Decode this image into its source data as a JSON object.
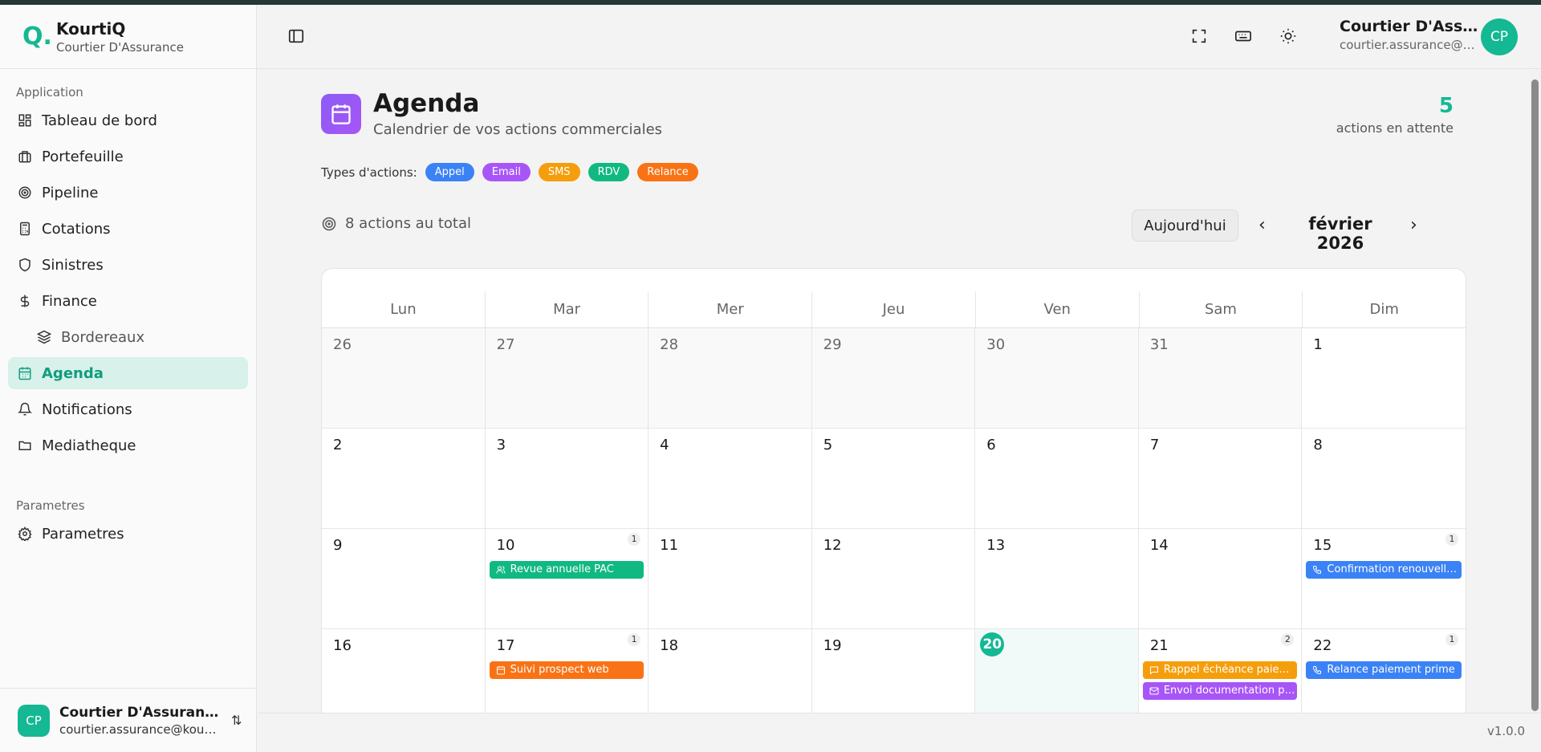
{
  "brand": {
    "logo": "Q.",
    "name": "KourtiQ",
    "subtitle": "Courtier D'Assurance"
  },
  "sidebar": {
    "section_app": "Application",
    "items": [
      {
        "label": "Tableau de bord",
        "icon": "dashboard-icon"
      },
      {
        "label": "Portefeuille",
        "icon": "briefcase-icon"
      },
      {
        "label": "Pipeline",
        "icon": "target-icon"
      },
      {
        "label": "Cotations",
        "icon": "calculator-icon"
      },
      {
        "label": "Sinistres",
        "icon": "shield-icon"
      },
      {
        "label": "Finance",
        "icon": "dollar-icon"
      },
      {
        "label": "Bordereaux",
        "icon": "layers-icon"
      },
      {
        "label": "Agenda",
        "icon": "calendar-icon"
      },
      {
        "label": "Notifications",
        "icon": "bell-icon"
      },
      {
        "label": "Mediatheque",
        "icon": "folder-icon"
      }
    ],
    "section_params": "Parametres",
    "params_item": {
      "label": "Parametres",
      "icon": "gear-icon"
    },
    "active": "Agenda"
  },
  "user": {
    "initials": "CP",
    "name": "Courtier D'Assurance",
    "email": "courtier.assurance@kourtiq.com"
  },
  "page": {
    "title": "Agenda",
    "subtitle": "Calendrier de vos actions commerciales",
    "pending_count": "5",
    "pending_label": "actions en attente",
    "types_label": "Types d'actions:",
    "types": [
      {
        "label": "Appel",
        "color": "#3b82f6"
      },
      {
        "label": "Email",
        "color": "#a855f7"
      },
      {
        "label": "SMS",
        "color": "#f59e0b"
      },
      {
        "label": "RDV",
        "color": "#10b981"
      },
      {
        "label": "Relance",
        "color": "#f97316"
      }
    ],
    "total": "8 actions au total",
    "today_button": "Aujourd'hui",
    "month": "février 2026"
  },
  "calendar": {
    "weekdays": [
      "Lun",
      "Mar",
      "Mer",
      "Jeu",
      "Ven",
      "Sam",
      "Dim"
    ],
    "days": [
      {
        "n": "26",
        "other": true
      },
      {
        "n": "27",
        "other": true
      },
      {
        "n": "28",
        "other": true
      },
      {
        "n": "29",
        "other": true
      },
      {
        "n": "30",
        "other": true
      },
      {
        "n": "31",
        "other": true
      },
      {
        "n": "1"
      },
      {
        "n": "2"
      },
      {
        "n": "3"
      },
      {
        "n": "4"
      },
      {
        "n": "5"
      },
      {
        "n": "6"
      },
      {
        "n": "7"
      },
      {
        "n": "8"
      },
      {
        "n": "9"
      },
      {
        "n": "10",
        "count": "1",
        "events": [
          {
            "title": "Revue annuelle PAC",
            "type": "RDV"
          }
        ]
      },
      {
        "n": "11"
      },
      {
        "n": "12"
      },
      {
        "n": "13"
      },
      {
        "n": "14"
      },
      {
        "n": "15",
        "count": "1",
        "events": [
          {
            "title": "Confirmation renouvellement",
            "type": "Appel"
          }
        ]
      },
      {
        "n": "16"
      },
      {
        "n": "17",
        "count": "1",
        "events": [
          {
            "title": "Suivi prospect web",
            "type": "Relance"
          }
        ]
      },
      {
        "n": "18"
      },
      {
        "n": "19"
      },
      {
        "n": "20",
        "today": true
      },
      {
        "n": "21",
        "count": "2",
        "events": [
          {
            "title": "Rappel échéance paiement",
            "type": "SMS"
          },
          {
            "title": "Envoi documentation produit",
            "type": "Email"
          }
        ]
      },
      {
        "n": "22",
        "count": "1",
        "events": [
          {
            "title": "Relance paiement prime",
            "type": "Appel"
          }
        ]
      }
    ]
  },
  "version": "v1.0.0"
}
